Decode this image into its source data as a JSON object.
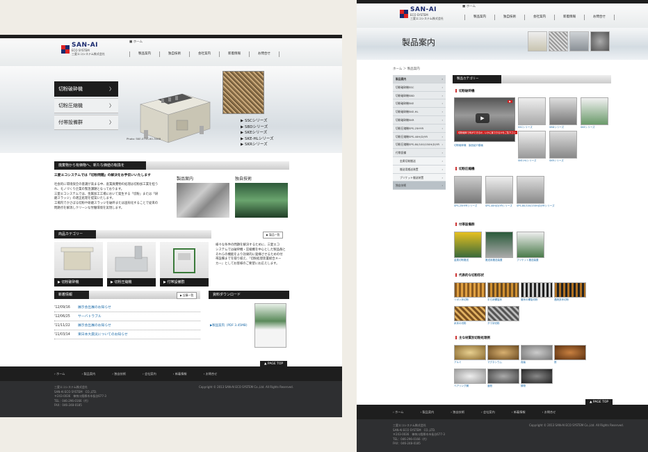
{
  "brand": {
    "name": "SAN-AI",
    "tagline": "ECO SYSTEM",
    "company_jp": "三愛エコシステム株式会社"
  },
  "page1": {
    "breadcrumb": "ホーム",
    "nav": [
      "製品案内",
      "独自技術",
      "会社案内",
      "新着情報",
      "お問合せ"
    ],
    "hero": {
      "menu": [
        "切粉破砕機",
        "切粉圧縮機",
        "付帯設備群"
      ],
      "series": [
        "SSCシリーズ",
        "SBDシリーズ",
        "SKEシリーズ",
        "SKE-HLシリーズ",
        "SKRシリーズ"
      ],
      "caption": "Photo: SKE-075S-60-300B"
    },
    "intro": {
      "heading": "廃棄物から有価物へ、新たな価値の転換を",
      "lead": "三愛エコシステムでは『切粉問題』の解決をお手伝いいたします",
      "lines": [
        "社会的に環境保全の意識が高まる中、産業廃棄物の処理は切粉加工業を担う",
        "れ、モノづくり企業の緊急課題となっております。",
        "三愛エコシステムでは、金属加工工場において発生する「切粉」または「研",
        "磨スラッジ」の適正処理を提案いたします。",
        "工場内でかさばる切粉や研磨スラッジを破砕または固形化することで従来の",
        "問題点を解消しクリーンな労働環境を実現します。"
      ]
    },
    "cards": [
      {
        "label": "製品案内"
      },
      {
        "label": "独自技術"
      }
    ],
    "category": {
      "heading": "商品カテゴリー",
      "more": "製品一覧",
      "items": [
        "切粉破砕機",
        "切粉圧縮機",
        "付帯設備群"
      ],
      "desc": [
        "様々な条件の問題を解決するために、三愛エコ",
        "システムでは破砕機・圧縮機を中心とした製品群と",
        "それらの機能をより効果的に発揮させるための付",
        "帯設備までを取り揃え、『切粉処理装置総合メー",
        "カー』としてお客様のご要望にお応えします。"
      ]
    },
    "news": {
      "heading": "新着情報",
      "more": "記事一覧",
      "items": [
        {
          "date": "'12/09/16",
          "title": "展示会出展のお知らせ"
        },
        {
          "date": "'12/06/25",
          "title": "サーバトラブル"
        },
        {
          "date": "'11/11/22",
          "title": "展示会出展のお知らせ"
        },
        {
          "date": "'11/03/14",
          "title": "東日本大震災についてのお知らせ"
        }
      ]
    },
    "download": {
      "heading": "資料ダウンロード",
      "link": "製品案内（PDF 3.45MB）"
    },
    "pagetop": "PAGE TOP",
    "footer_nav": [
      "ホーム",
      "製品案内",
      "独自技術",
      "会社案内",
      "新着情報",
      "お問合せ"
    ],
    "footer": {
      "lines": [
        "三愛エコシステム株式会社",
        "SAN-AI ECO SYSTEM　CO.,LTD.",
        "〒243-0036　神奈川県厚木市長谷677-3",
        "TEL：046-296-0166（代）",
        "FAX：046-248-0185"
      ],
      "copyright": "Copyright © 2013 SAN-AI ECO SYSTEM Co.,Ltd. All Rights Reserved."
    }
  },
  "page2": {
    "nav": [
      "製品案内",
      "独自技術",
      "会社案内",
      "新着情報",
      "お問合せ"
    ],
    "title": "製品案内",
    "breadcrumb": "ホーム ＞ 製品案内",
    "sidebar": [
      {
        "label": "製品案内",
        "kind": "hd"
      },
      {
        "label": "切粉破砕機SSC",
        "kind": "item"
      },
      {
        "label": "切粉破砕機SBD",
        "kind": "item"
      },
      {
        "label": "切粉破砕機SKE",
        "kind": "item"
      },
      {
        "label": "切粉破砕機SKE-HL",
        "kind": "item"
      },
      {
        "label": "切粉破砕機SKR",
        "kind": "item"
      },
      {
        "label": "切粉圧縮機SPS-25HYR",
        "kind": "item"
      },
      {
        "label": "切粉圧縮機SPS-40H(D)YR",
        "kind": "item"
      },
      {
        "label": "切粉圧縮機SPS-80/100/150H(D)YR",
        "kind": "item"
      },
      {
        "label": "付帯設備",
        "kind": "item"
      },
      {
        "label": "金属切粉搬送",
        "kind": "sub"
      },
      {
        "label": "搬送用搬送装置",
        "kind": "sub"
      },
      {
        "label": "ブリケット搬送装置",
        "kind": "sub"
      },
      {
        "label": "独自技術",
        "kind": "act"
      }
    ],
    "category_heading": "製品カテゴリー",
    "sections": {
      "crusher": "切粉破砕機",
      "compressor": "切粉圧縮機",
      "equipment": "付帯設備群",
      "chips": "代表的な切粉形状",
      "materials": "主な材質別切粉処理例"
    },
    "video_caption": "切粉破砕機　製品紹介動画",
    "video_banner": "切粉破砕で何ができるか、いかに楽できるかをご覧下さい",
    "crusher_items": [
      "SSCシリーズ",
      "SBDシリーズ",
      "SKEシリーズ",
      "SKE-HLシリーズ",
      "SKRシリーズ"
    ],
    "compressor_items": [
      "SPS-25HYRシリーズ",
      "SPS-40H(D)YRシリーズ",
      "SPS-80/100/150H(D)YRシリーズ"
    ],
    "equipment_items": [
      "金属切粉搬送",
      "搬送用搬送装置",
      "ブリケット搬送装置"
    ],
    "chip_items": [
      "リボン状切粉",
      "平ら状螺旋状",
      "管状の螺旋切粉",
      "連続多状切粉",
      "糸状の切粉",
      "ダマ状切粉"
    ],
    "material_items": [
      "アルミ",
      "マグネシウム",
      "真鍮",
      "鉄",
      "ベアリング鋼",
      "亜鉛",
      "鋳物"
    ],
    "pagetop": "PAGE TOP",
    "footer_nav": [
      "ホーム",
      "製品案内",
      "独自技術",
      "会社案内",
      "新着情報",
      "お問合せ"
    ],
    "footer": {
      "lines": [
        "三愛エコシステム株式会社",
        "SAN-AI ECO SYSTEM　CO.,LTD.",
        "〒243-0036　神奈川県厚木市長谷677-3",
        "TEL：046-296-0166（代）",
        "FAX：046-248-0185"
      ],
      "copyright": "Copyright © 2013 SAN-AI ECO SYSTEM Co.,Ltd. All Rights Reserved."
    }
  },
  "colors": {
    "accent_red": "#c33333",
    "logo_blue": "#1a2a6e",
    "link_blue": "#1a6aa8",
    "dark": "#1e1e1e"
  }
}
